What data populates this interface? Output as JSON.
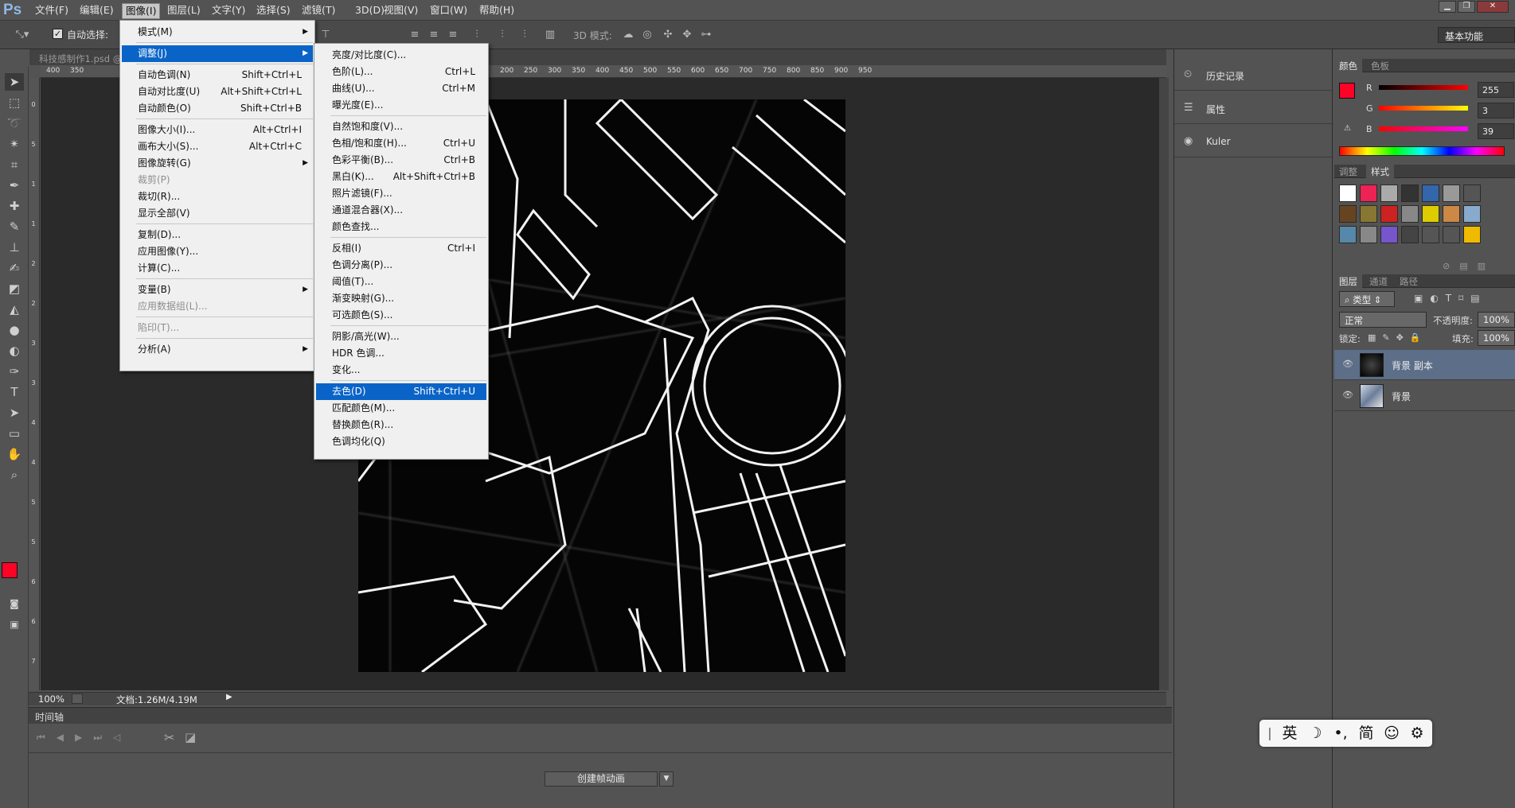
{
  "app": {
    "logo": "Ps"
  },
  "menubar": {
    "items": [
      "文件(F)",
      "编辑(E)",
      "图像(I)",
      "图层(L)",
      "文字(Y)",
      "选择(S)",
      "滤镜(T)",
      "3D(D)",
      "视图(V)",
      "窗口(W)",
      "帮助(H)"
    ],
    "active_index": 2
  },
  "options": {
    "auto_select_label": "自动选择:",
    "mode3d_label": "3D 模式:",
    "workspace": "基本功能"
  },
  "document": {
    "tab_title": "科技感制作1.psd @",
    "zoom": "100%",
    "doc_info": "文档:1.26M/4.19M"
  },
  "ruler": {
    "h_ticks": [
      "400",
      "350",
      "",
      "",
      "",
      "",
      "",
      "",
      "",
      "",
      "",
      "",
      "",
      "",
      "",
      "",
      "",
      "",
      "",
      "200",
      "250",
      "300",
      "350",
      "400",
      "450",
      "500",
      "550",
      "600",
      "650",
      "700",
      "750",
      "800",
      "850",
      "900",
      "950"
    ],
    "v_ticks": [
      "0",
      "5",
      "1",
      "1",
      "2",
      "2",
      "3",
      "3",
      "4",
      "4",
      "5",
      "5",
      "6",
      "6",
      "7"
    ]
  },
  "image_menu": {
    "items": [
      {
        "label": "模式(M)",
        "shortcut": "",
        "submenu": true
      },
      {
        "sep": true
      },
      {
        "label": "调整(J)",
        "shortcut": "",
        "submenu": true,
        "highlight": true
      },
      {
        "sep": true
      },
      {
        "label": "自动色调(N)",
        "shortcut": "Shift+Ctrl+L"
      },
      {
        "label": "自动对比度(U)",
        "shortcut": "Alt+Shift+Ctrl+L"
      },
      {
        "label": "自动颜色(O)",
        "shortcut": "Shift+Ctrl+B"
      },
      {
        "sep": true
      },
      {
        "label": "图像大小(I)...",
        "shortcut": "Alt+Ctrl+I"
      },
      {
        "label": "画布大小(S)...",
        "shortcut": "Alt+Ctrl+C"
      },
      {
        "label": "图像旋转(G)",
        "shortcut": "",
        "submenu": true
      },
      {
        "label": "裁剪(P)",
        "shortcut": "",
        "disabled": true
      },
      {
        "label": "裁切(R)...",
        "shortcut": ""
      },
      {
        "label": "显示全部(V)",
        "shortcut": ""
      },
      {
        "sep": true
      },
      {
        "label": "复制(D)...",
        "shortcut": ""
      },
      {
        "label": "应用图像(Y)...",
        "shortcut": ""
      },
      {
        "label": "计算(C)...",
        "shortcut": ""
      },
      {
        "sep": true
      },
      {
        "label": "变量(B)",
        "shortcut": "",
        "submenu": true
      },
      {
        "label": "应用数据组(L)...",
        "shortcut": "",
        "disabled": true
      },
      {
        "sep": true
      },
      {
        "label": "陷印(T)...",
        "shortcut": "",
        "disabled": true
      },
      {
        "sep": true
      },
      {
        "label": "分析(A)",
        "shortcut": "",
        "submenu": true
      }
    ]
  },
  "adjust_menu": {
    "items": [
      {
        "label": "亮度/对比度(C)...",
        "shortcut": ""
      },
      {
        "label": "色阶(L)...",
        "shortcut": "Ctrl+L"
      },
      {
        "label": "曲线(U)...",
        "shortcut": "Ctrl+M"
      },
      {
        "label": "曝光度(E)...",
        "shortcut": ""
      },
      {
        "sep": true
      },
      {
        "label": "自然饱和度(V)...",
        "shortcut": ""
      },
      {
        "label": "色相/饱和度(H)...",
        "shortcut": "Ctrl+U"
      },
      {
        "label": "色彩平衡(B)...",
        "shortcut": "Ctrl+B"
      },
      {
        "label": "黑白(K)...",
        "shortcut": "Alt+Shift+Ctrl+B"
      },
      {
        "label": "照片滤镜(F)...",
        "shortcut": ""
      },
      {
        "label": "通道混合器(X)...",
        "shortcut": ""
      },
      {
        "label": "颜色查找...",
        "shortcut": ""
      },
      {
        "sep": true
      },
      {
        "label": "反相(I)",
        "shortcut": "Ctrl+I"
      },
      {
        "label": "色调分离(P)...",
        "shortcut": ""
      },
      {
        "label": "阈值(T)...",
        "shortcut": ""
      },
      {
        "label": "渐变映射(G)...",
        "shortcut": ""
      },
      {
        "label": "可选颜色(S)...",
        "shortcut": ""
      },
      {
        "sep": true
      },
      {
        "label": "阴影/高光(W)...",
        "shortcut": ""
      },
      {
        "label": "HDR 色调...",
        "shortcut": ""
      },
      {
        "label": "变化...",
        "shortcut": ""
      },
      {
        "sep": true
      },
      {
        "label": "去色(D)",
        "shortcut": "Shift+Ctrl+U",
        "highlight": true
      },
      {
        "label": "匹配颜色(M)...",
        "shortcut": ""
      },
      {
        "label": "替换颜色(R)...",
        "shortcut": ""
      },
      {
        "label": "色调均化(Q)",
        "shortcut": ""
      }
    ]
  },
  "timeline": {
    "title": "时间轴",
    "create_button": "创建帧动画"
  },
  "mid_panels": {
    "history": "历史记录",
    "properties": "属性",
    "kuler": "Kuler"
  },
  "color_panel": {
    "tabs": [
      "颜色",
      "色板"
    ],
    "r_label": "R",
    "g_label": "G",
    "b_label": "B",
    "r": "255",
    "g": "3",
    "b": "39",
    "fg_color": "#ff0327",
    "bg_color": "#c00000"
  },
  "styles_panel": {
    "tabs": [
      "调整",
      "样式"
    ]
  },
  "layers_panel": {
    "tabs": [
      "图层",
      "通道",
      "路径"
    ],
    "filter_kind": "类型",
    "blend_mode": "正常",
    "opacity_label": "不透明度:",
    "opacity": "100%",
    "lock_label": "锁定:",
    "fill_label": "填充:",
    "fill": "100%",
    "layers": [
      {
        "name": "背景 副本",
        "selected": true
      },
      {
        "name": "背景",
        "selected": false
      }
    ]
  },
  "ime": {
    "divider": "|",
    "lang": "英",
    "mode": "简"
  }
}
